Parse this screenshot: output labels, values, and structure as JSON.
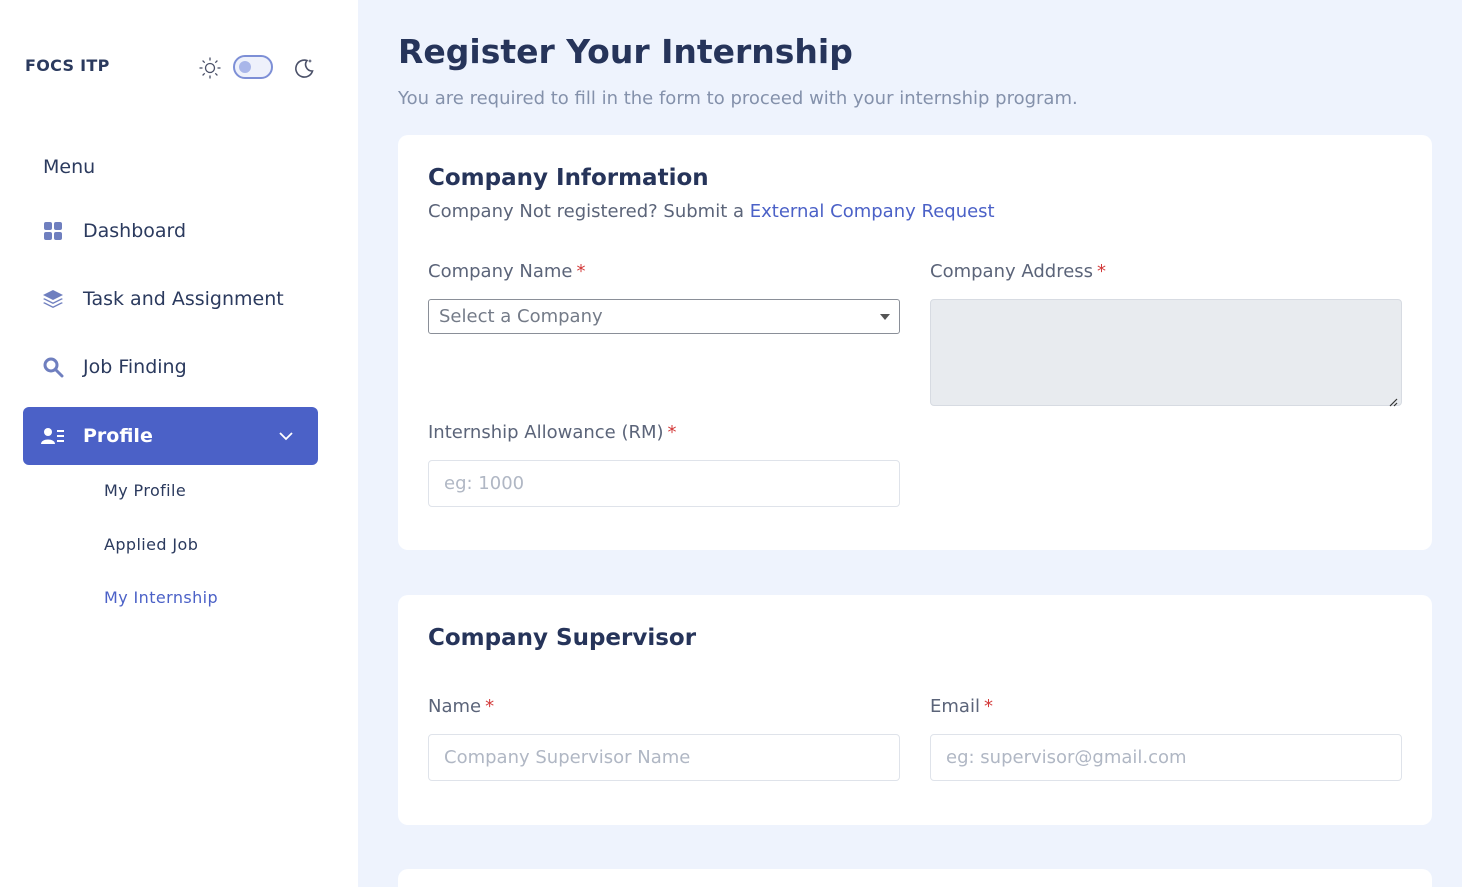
{
  "sidebar": {
    "brand": "FOCS ITP",
    "menu_title": "Menu",
    "items": [
      {
        "label": "Dashboard",
        "icon": "grid-icon"
      },
      {
        "label": "Task and Assignment",
        "icon": "layers-icon"
      },
      {
        "label": "Job Finding",
        "icon": "search-icon"
      },
      {
        "label": "Profile",
        "icon": "user-list-icon",
        "active": true,
        "expanded": true
      }
    ],
    "subitems": [
      {
        "label": "My Profile"
      },
      {
        "label": "Applied Job"
      },
      {
        "label": "My Internship",
        "active": true
      }
    ]
  },
  "header": {
    "title": "Register Your Internship",
    "subtitle": "You are required to fill in the form to proceed with your internship program."
  },
  "company_info": {
    "title": "Company Information",
    "note_prefix": "Company Not registered? Submit a ",
    "note_link": "External Company Request",
    "company_name_label": "Company Name",
    "company_name_value": "Select a Company",
    "company_address_label": "Company Address",
    "allowance_label": "Internship Allowance (RM)",
    "allowance_placeholder": "eg: 1000",
    "required_mark": "*"
  },
  "supervisor": {
    "title": "Company Supervisor",
    "name_label": "Name",
    "name_placeholder": "Company Supervisor Name",
    "email_label": "Email",
    "email_placeholder": "eg: supervisor@gmail.com",
    "required_mark": "*"
  },
  "colors": {
    "accent": "#4b61c7",
    "background": "#eef3fd",
    "heading": "#26345a",
    "required": "#d33a3a"
  }
}
